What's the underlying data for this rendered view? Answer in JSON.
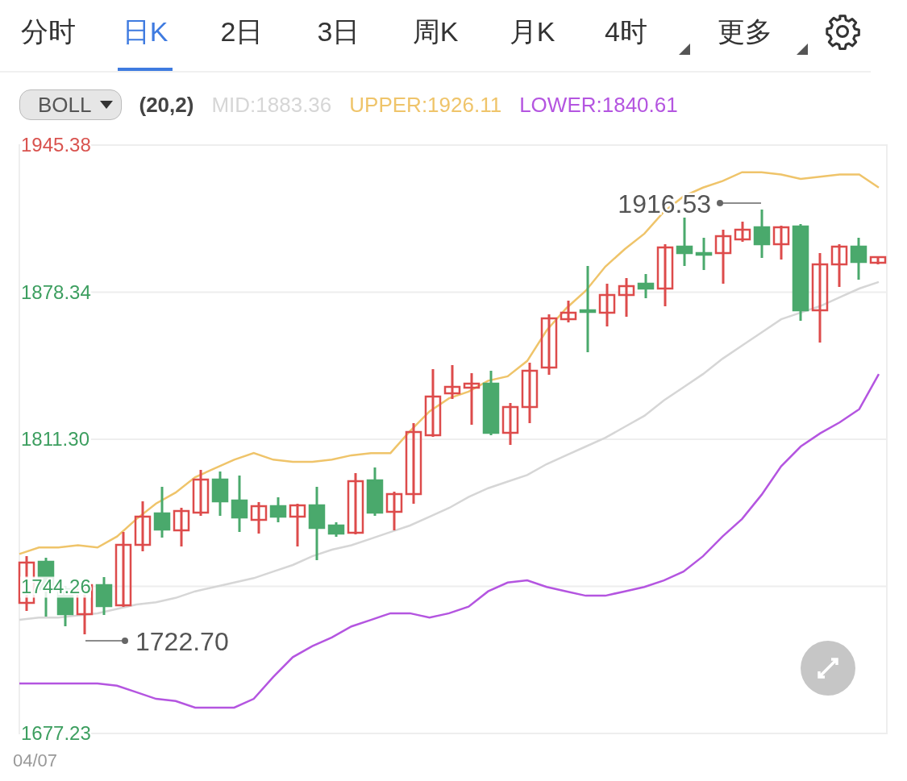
{
  "tabs": [
    {
      "label": "分时",
      "selected": false,
      "kind": "plain"
    },
    {
      "label": "日K",
      "selected": true,
      "kind": "plain"
    },
    {
      "label": "2日",
      "selected": false,
      "kind": "plain"
    },
    {
      "label": "3日",
      "selected": false,
      "kind": "plain"
    },
    {
      "label": "周K",
      "selected": false,
      "kind": "plain"
    },
    {
      "label": "月K",
      "selected": false,
      "kind": "plain"
    },
    {
      "label": "4时",
      "selected": false,
      "kind": "dropdown"
    },
    {
      "label": "更多",
      "selected": false,
      "kind": "dropdown"
    }
  ],
  "indicator": {
    "name": "BOLL",
    "params": "(20,2)",
    "values": [
      {
        "label": "MID:1883.36",
        "color": "#d6d6d6"
      },
      {
        "label": "UPPER:1926.11",
        "color": "#efc46a"
      },
      {
        "label": "LOWER:1840.61",
        "color": "#b455e0"
      }
    ]
  },
  "chart": {
    "y_labels": [
      {
        "color": "#d9534f"
      },
      {
        "color": "#3c9e5f"
      },
      {
        "color": "#3c9e5f"
      },
      {
        "color": "#3c9e5f"
      },
      {
        "color": "#3c9e5f"
      }
    ],
    "max_marker": "1916.53",
    "min_marker": "1722.70",
    "x_label": "04/07",
    "chart_data": {
      "type": "line",
      "grid": true,
      "ylim": [
        1677.23,
        1945.38
      ],
      "yticks": [
        {
          "value": 1945.38,
          "label": "1945.38"
        },
        {
          "value": 1878.34,
          "label": "1878.34"
        },
        {
          "value": 1811.3,
          "label": "1811.30"
        },
        {
          "value": 1744.26,
          "label": "1744.26"
        },
        {
          "value": 1677.23,
          "label": "1677.23"
        }
      ],
      "series": [
        {
          "color": "#d6d6d6",
          "values": [
            1729,
            1730,
            1730,
            1731,
            1732,
            1734,
            1736,
            1737,
            1739,
            1742,
            1744,
            1746,
            1748,
            1751,
            1754,
            1758,
            1761,
            1763,
            1766,
            1769,
            1772,
            1776,
            1780,
            1785,
            1789,
            1792,
            1795,
            1800,
            1804,
            1808,
            1812,
            1817,
            1822,
            1829,
            1835,
            1841,
            1848,
            1854,
            1860,
            1866,
            1869,
            1872,
            1876,
            1880,
            1883
          ]
        },
        {
          "color": "#efc46a",
          "values": [
            1759,
            1762,
            1762,
            1763,
            1762,
            1767,
            1775,
            1782,
            1787,
            1794,
            1798,
            1802,
            1805,
            1802,
            1801,
            1801,
            1802,
            1804,
            1805,
            1805,
            1815,
            1824,
            1830,
            1833,
            1838,
            1840,
            1847,
            1861,
            1871,
            1879,
            1890,
            1898,
            1905,
            1915,
            1922,
            1926,
            1929,
            1933,
            1933,
            1932,
            1930,
            1931,
            1932,
            1932,
            1926
          ]
        },
        {
          "color": "#b455e0",
          "values": [
            1700,
            1700,
            1700,
            1700,
            1700,
            1699,
            1696,
            1693,
            1692,
            1689,
            1689,
            1689,
            1693,
            1703,
            1712,
            1717,
            1721,
            1726,
            1729,
            1732,
            1732,
            1730,
            1732,
            1735,
            1742,
            1746,
            1747,
            1744,
            1742,
            1740,
            1740,
            1742,
            1744,
            1747,
            1751,
            1758,
            1767,
            1775,
            1786,
            1799,
            1808,
            1814,
            1819,
            1825,
            1841
          ]
        }
      ]
    }
  }
}
